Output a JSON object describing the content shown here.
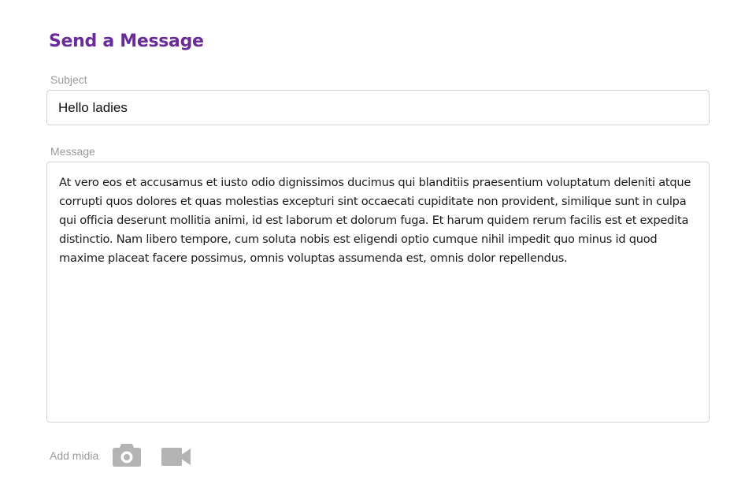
{
  "form": {
    "title": "Send a Message",
    "subject": {
      "label": "Subject",
      "value": "Hello ladies"
    },
    "message": {
      "label": "Message",
      "value": "At vero eos et accusamus et iusto odio dignissimos ducimus qui blanditiis praesentium voluptatum deleniti atque corrupti quos dolores et quas molestias excepturi sint occaecati cupiditate non provident, similique sunt in culpa qui officia deserunt mollitia animi, id est laborum et dolorum fuga. Et harum quidem rerum facilis est et expedita distinctio. Nam libero tempore, cum soluta nobis est eligendi optio cumque nihil impedit quo minus id quod maxime placeat facere possimus, omnis voluptas assumenda est, omnis dolor repellendus."
    },
    "media": {
      "label": "Add midia",
      "icons": [
        "camera-icon",
        "video-camera-icon"
      ]
    }
  },
  "colors": {
    "title": "#6a2c98",
    "label": "#9a9a9a",
    "border": "#d2d2d2",
    "icon": "#b4b4b4"
  }
}
